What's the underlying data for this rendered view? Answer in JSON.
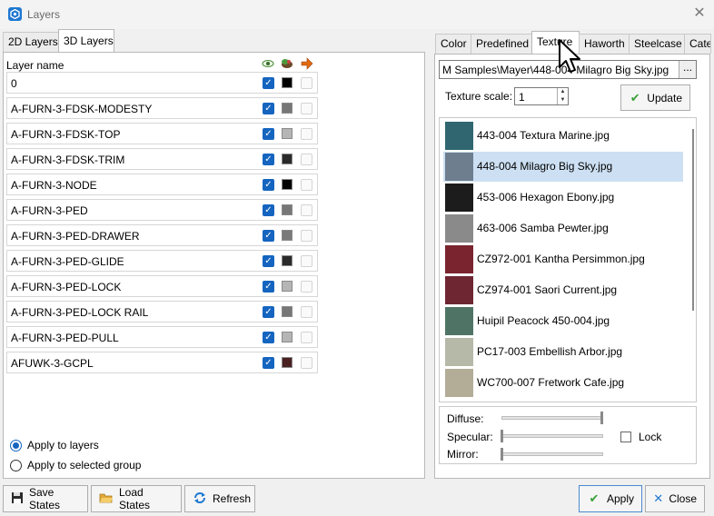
{
  "window": {
    "title": "Layers",
    "close_icon": "close-icon"
  },
  "left_tabs": [
    {
      "label": "2D Layers",
      "active": false
    },
    {
      "label": "3D Layers",
      "active": true
    }
  ],
  "layer_table": {
    "header": "Layer name",
    "header_icons": [
      "visible-eye-icon",
      "render-icon",
      "color-arrow-icon"
    ],
    "rows": [
      {
        "name": "0",
        "checked": true,
        "swatch": "#000000"
      },
      {
        "name": "A-FURN-3-FDSK-MODESTY",
        "checked": true,
        "swatch": "#777777"
      },
      {
        "name": "A-FURN-3-FDSK-TOP",
        "checked": true,
        "swatch": "#b5b5b5"
      },
      {
        "name": "A-FURN-3-FDSK-TRIM",
        "checked": true,
        "swatch": "#2a2a2a"
      },
      {
        "name": "A-FURN-3-NODE",
        "checked": true,
        "swatch": "#000000"
      },
      {
        "name": "A-FURN-3-PED",
        "checked": true,
        "swatch": "#777777"
      },
      {
        "name": "A-FURN-3-PED-DRAWER",
        "checked": true,
        "swatch": "#7a7a7a"
      },
      {
        "name": "A-FURN-3-PED-GLIDE",
        "checked": true,
        "swatch": "#2a2a2a"
      },
      {
        "name": "A-FURN-3-PED-LOCK",
        "checked": true,
        "swatch": "#b5b5b5"
      },
      {
        "name": "A-FURN-3-PED-LOCK RAIL",
        "checked": true,
        "swatch": "#777777"
      },
      {
        "name": "A-FURN-3-PED-PULL",
        "checked": true,
        "swatch": "#b5b5b5"
      },
      {
        "name": "AFUWK-3-GCPL",
        "checked": true,
        "swatch": "#4a2020"
      }
    ]
  },
  "apply": {
    "option1": "Apply to layers",
    "option2": "Apply to selected group",
    "selected": "option1"
  },
  "bottom_buttons": {
    "save": "Save States",
    "load": "Load States",
    "refresh": "Refresh",
    "apply": "Apply",
    "close": "Close"
  },
  "right_tabs": [
    {
      "label": "Color",
      "active": false
    },
    {
      "label": "Predefined",
      "active": false
    },
    {
      "label": "Texture",
      "active": true
    },
    {
      "label": "Haworth",
      "active": false
    },
    {
      "label": "Steelcase",
      "active": false
    },
    {
      "label": "Cate",
      "active": false
    }
  ],
  "texture": {
    "path": "M Samples\\Mayer\\448-004 Milagro Big Sky.jpg",
    "browse_label": "...",
    "scale_label": "Texture scale:",
    "scale_value": "1",
    "update_label": "Update",
    "items": [
      {
        "name": "443-004 Textura Marine.jpg",
        "color": "#2f6670",
        "selected": false
      },
      {
        "name": "448-004 Milagro Big Sky.jpg",
        "color": "#6f7e8e",
        "selected": true
      },
      {
        "name": "453-006 Hexagon Ebony.jpg",
        "color": "#1c1c1c",
        "selected": false
      },
      {
        "name": "463-006 Samba Pewter.jpg",
        "color": "#8a8a8a",
        "selected": false
      },
      {
        "name": "CZ972-001 Kantha Persimmon.jpg",
        "color": "#7a2430",
        "selected": false
      },
      {
        "name": "CZ974-001 Saori Current.jpg",
        "color": "#6e2632",
        "selected": false
      },
      {
        "name": "Huipil Peacock 450-004.jpg",
        "color": "#4f7466",
        "selected": false
      },
      {
        "name": "PC17-003 Embellish Arbor.jpg",
        "color": "#b6b8a8",
        "selected": false
      },
      {
        "name": "WC700-007 Fretwork Cafe.jpg",
        "color": "#b3ad98",
        "selected": false
      }
    ]
  },
  "properties": {
    "diffuse": {
      "label": "Diffuse:",
      "value": 1.0
    },
    "specular": {
      "label": "Specular:",
      "value": 0.0
    },
    "mirror": {
      "label": "Mirror:",
      "value": 0.0
    },
    "lock_label": "Lock",
    "lock_checked": false
  }
}
